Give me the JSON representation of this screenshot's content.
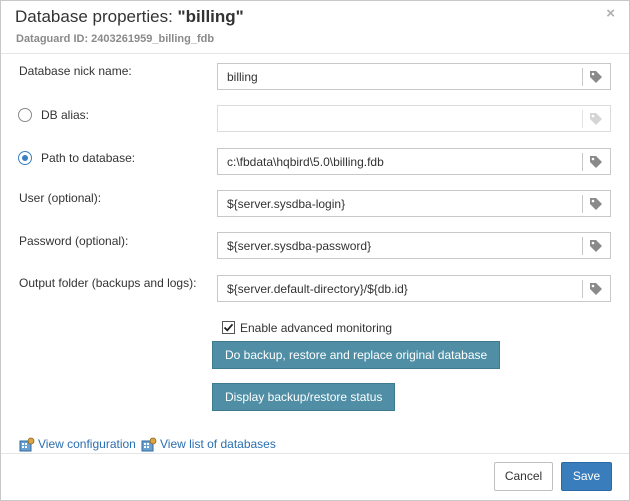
{
  "dialog": {
    "title_prefix": "Database properties: ",
    "title_name": "\"billing\"",
    "subtitle": "Dataguard ID: 2403261959_billing_fdb",
    "close_icon": "×"
  },
  "form": {
    "nickname": {
      "label": "Database nick name:",
      "value": "billing"
    },
    "db_alias": {
      "label": "DB alias:",
      "value": "",
      "selected": false
    },
    "path": {
      "label": "Path to database:",
      "value": "c:\\fbdata\\hqbird\\5.0\\billing.fdb",
      "selected": true
    },
    "user": {
      "label": "User (optional):",
      "value": "${server.sysdba-login}"
    },
    "password": {
      "label": "Password (optional):",
      "value": "${server.sysdba-password}"
    },
    "output": {
      "label": "Output folder (backups and logs):",
      "value": "${server.default-directory}/${db.id}"
    }
  },
  "monitoring": {
    "label": "Enable advanced monitoring",
    "checked": true
  },
  "actions": {
    "backup_restore_label": "Do backup, restore and replace original database",
    "status_label": "Display backup/restore status"
  },
  "links": {
    "view_config": "View configuration",
    "view_list": "View list of databases"
  },
  "footer": {
    "cancel_label": "Cancel",
    "save_label": "Save"
  },
  "colors": {
    "accent": "#3a7dbd",
    "teal_button": "#4f8ea4",
    "link": "#2a6fb0"
  },
  "icons": {
    "field_action": "tag-icon",
    "link": "database-config-icon"
  }
}
